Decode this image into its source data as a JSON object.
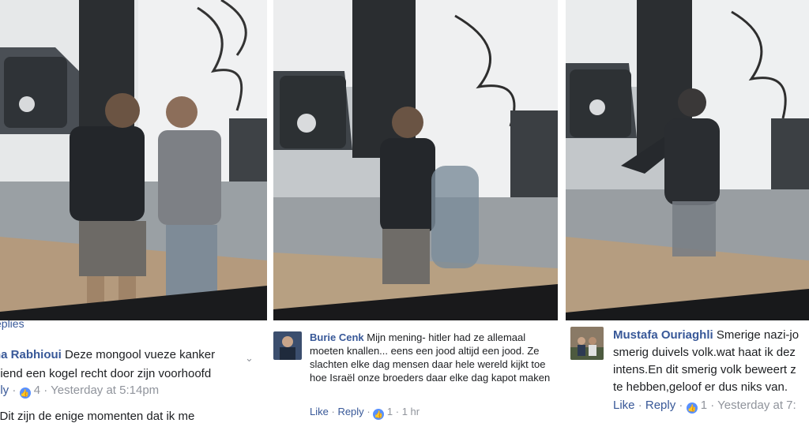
{
  "panels": [
    {
      "replies_link": "eplies",
      "comment": {
        "author": "na Rabhioui",
        "line1": "Deze mongool vueze kanker",
        "line2": "diend een kogel recht door zijn voorhoofd",
        "actions": {
          "reply": "ply",
          "likes": "4",
          "time": "Yesterday at 5:14pm"
        }
      },
      "next_comment_partial": "l Dit zijn de enige momenten dat ik me"
    },
    {
      "comment": {
        "author": "Burie Cenk",
        "text": "Mijn mening- hitler had ze allemaal moeten knallen... eens een jood altijd een jood. Ze slachten elke dag mensen daar hele wereld kijkt toe hoe Israël onze broeders daar elke dag kapot maken",
        "actions": {
          "like": "Like",
          "reply": "Reply",
          "likes": "1",
          "time": "1 hr"
        }
      }
    },
    {
      "comment": {
        "author": "Mustafa Ouriaghli",
        "line1": "Smerige nazi-jo",
        "line2": "smerig duivels volk.wat haat ik dez",
        "line3": "intens.En dit smerig volk beweert z",
        "line4": "te hebben,geloof er dus niks van.",
        "actions": {
          "like": "Like",
          "reply": "Reply",
          "likes": "1",
          "time": "Yesterday at 7:"
        }
      }
    }
  ],
  "icons": {
    "like_badge": "thumbs-up-icon",
    "chevron": "chevron-down-icon"
  },
  "colors": {
    "link": "#385898",
    "muted": "#90949c",
    "like_badge": "#5890ff"
  }
}
